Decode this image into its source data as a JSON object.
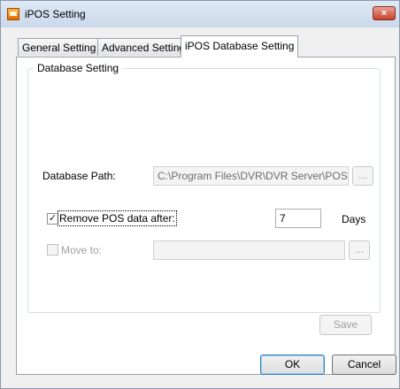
{
  "window": {
    "title": "iPOS Setting",
    "close_glyph": "×"
  },
  "tabs": [
    {
      "label": "General Setting",
      "active": false
    },
    {
      "label": "Advanced Setting",
      "active": false
    },
    {
      "label": "iPOS Database Setting",
      "active": true
    }
  ],
  "database_setting": {
    "group_label": "Database Setting",
    "path_label": "Database Path:",
    "path_value": "C:\\Program Files\\DVR\\DVR Server\\POSDB",
    "browse_label": "...",
    "remove": {
      "label": "Remove POS data after:",
      "checked": true,
      "value": "7",
      "unit": "Days"
    },
    "move": {
      "label": "Move to:",
      "checked": false,
      "value": "",
      "browse_label": "..."
    }
  },
  "buttons": {
    "save": "Save",
    "ok": "OK",
    "cancel": "Cancel"
  }
}
